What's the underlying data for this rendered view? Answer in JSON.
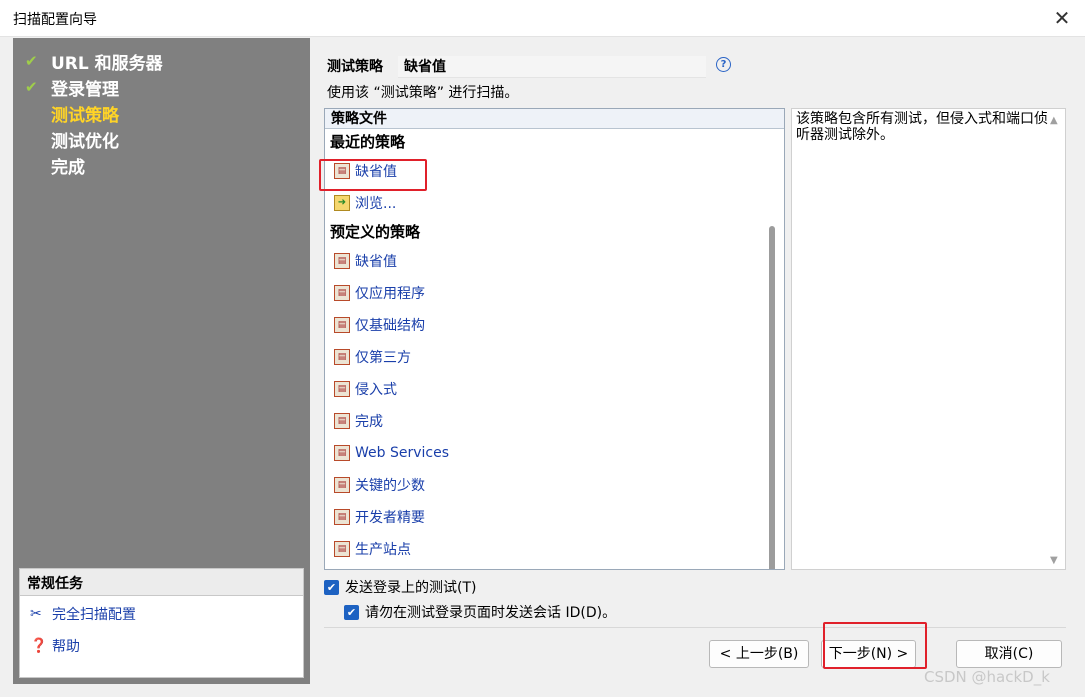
{
  "window": {
    "title": "扫描配置向导",
    "close_glyph": "✕"
  },
  "steps": [
    {
      "label": "URL 和服务器",
      "check": "✔"
    },
    {
      "label": "登录管理",
      "check": "✔"
    },
    {
      "label": "测试策略",
      "check": ""
    },
    {
      "label": "测试优化",
      "check": ""
    },
    {
      "label": "完成",
      "check": ""
    }
  ],
  "tasks": {
    "title": "常规任务",
    "items": [
      {
        "label": "完全扫描配置",
        "icon": "tools-icon"
      },
      {
        "label": "帮助",
        "icon": "help-icon"
      }
    ]
  },
  "policy": {
    "label": "测试策略",
    "value": "缺省值",
    "hint": "使用该 “测试策略” 进行扫描。",
    "list_header": "策略文件",
    "recent_title": "最近的策略",
    "recent": [
      "缺省值",
      "浏览..."
    ],
    "predefined_title": "预定义的策略",
    "predefined": [
      "缺省值",
      "仅应用程序",
      "仅基础结构",
      "仅第三方",
      "侵入式",
      "完成",
      "Web Services",
      "关键的少数",
      "开发者精要",
      "生产站点"
    ],
    "description": "该策略包含所有测试，但侵入式和端口侦听器测试除外。"
  },
  "options": {
    "send_login": "发送登录上的测试(T)",
    "no_session": "请勿在测试登录页面时发送会话 ID(D)。"
  },
  "buttons": {
    "back": "< 上一步(B)",
    "next": "下一步(N) >",
    "cancel": "取消(C)"
  },
  "watermark": "CSDN @hackD_k",
  "colors": {
    "current_step": "#ffd426",
    "highlight": "#e0202a",
    "link": "#1a3faa"
  }
}
